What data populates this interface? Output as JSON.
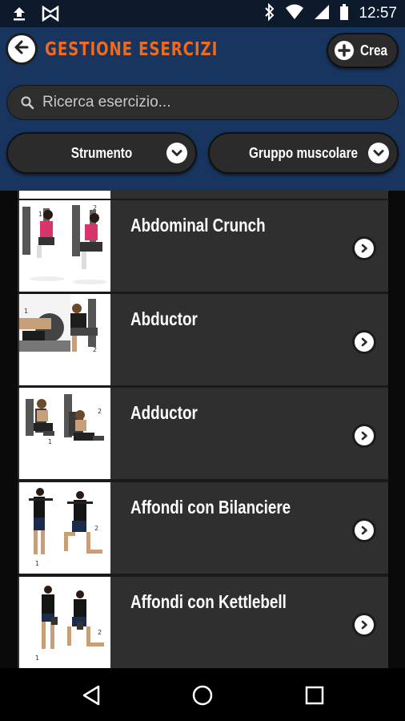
{
  "status_bar": {
    "time": "12:57",
    "icons": [
      "upload-icon",
      "bowtie-icon",
      "bluetooth-icon",
      "wifi-icon",
      "signal-icon",
      "battery-icon"
    ]
  },
  "header": {
    "title": "GESTIONE ESERCIZI",
    "create_label": "Crea",
    "accent_color": "#ee6a1e",
    "background_color": "#17355e"
  },
  "search": {
    "placeholder": "Ricerca esercizio..."
  },
  "filters": {
    "tool_label": "Strumento",
    "muscle_group_label": "Gruppo muscolare"
  },
  "exercises": [
    {
      "name": "Abdominal Crunch"
    },
    {
      "name": "Abductor"
    },
    {
      "name": "Adductor"
    },
    {
      "name": "Affondi con Bilanciere"
    },
    {
      "name": "Affondi con Kettlebell"
    }
  ],
  "nav_bar": {
    "icons": [
      "back-triangle-icon",
      "home-circle-icon",
      "recents-square-icon"
    ]
  }
}
